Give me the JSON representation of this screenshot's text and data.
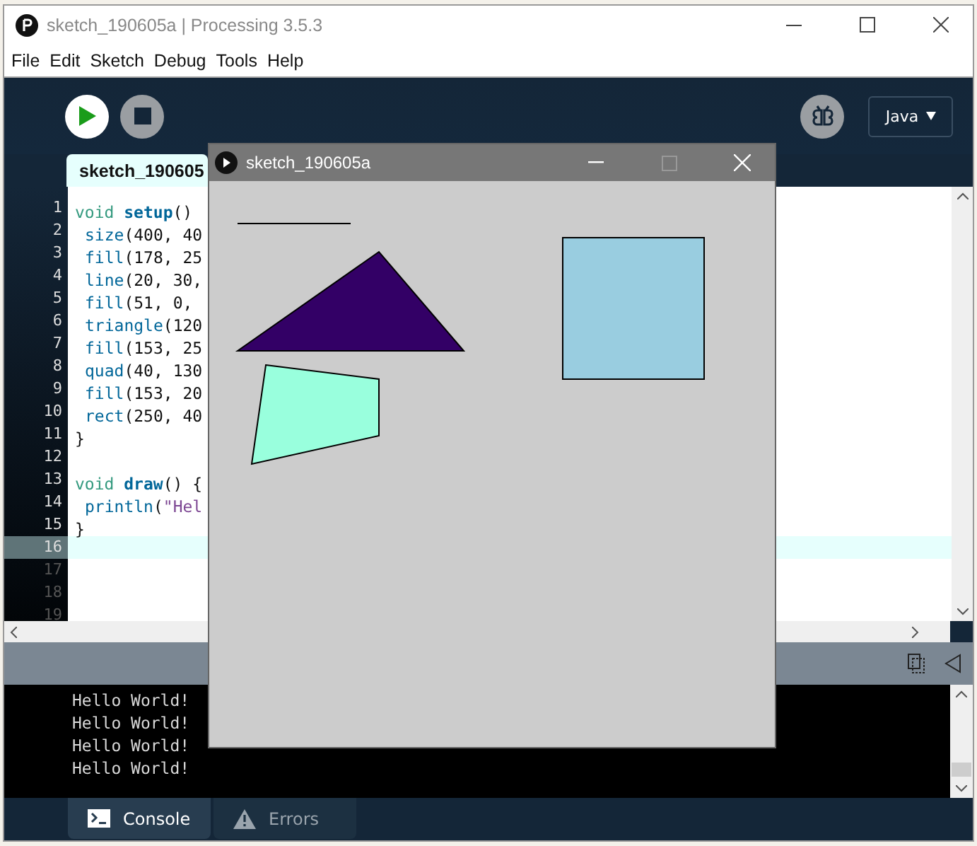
{
  "window": {
    "title": "sketch_190605a | Processing 3.5.3"
  },
  "menu": [
    "File",
    "Edit",
    "Sketch",
    "Debug",
    "Tools",
    "Help"
  ],
  "toolbar": {
    "mode": "Java"
  },
  "editor_tabs": [
    {
      "label": "sketch_190605",
      "selected": true
    }
  ],
  "code_lines": [
    {
      "number": "1",
      "current": false,
      "past_end": false,
      "tokens": [
        {
          "kind": "keyword",
          "text": "void "
        },
        {
          "kind": "definition",
          "text": "setup"
        },
        {
          "kind": "plain",
          "text": "()"
        }
      ]
    },
    {
      "number": "2",
      "current": false,
      "past_end": false,
      "indented": true,
      "tokens": [
        {
          "kind": "function",
          "text": "size"
        },
        {
          "kind": "plain",
          "text": "(400, 40"
        }
      ]
    },
    {
      "number": "3",
      "current": false,
      "past_end": false,
      "indented": true,
      "tokens": [
        {
          "kind": "function",
          "text": "fill"
        },
        {
          "kind": "plain",
          "text": "(178, 25"
        }
      ]
    },
    {
      "number": "4",
      "current": false,
      "past_end": false,
      "indented": true,
      "tokens": [
        {
          "kind": "function",
          "text": "line"
        },
        {
          "kind": "plain",
          "text": "(20, 30,"
        }
      ]
    },
    {
      "number": "5",
      "current": false,
      "past_end": false,
      "indented": true,
      "tokens": [
        {
          "kind": "function",
          "text": "fill"
        },
        {
          "kind": "plain",
          "text": "(51, 0,"
        }
      ]
    },
    {
      "number": "6",
      "current": false,
      "past_end": false,
      "indented": true,
      "tokens": [
        {
          "kind": "function",
          "text": "triangle"
        },
        {
          "kind": "plain",
          "text": "(120"
        }
      ]
    },
    {
      "number": "7",
      "current": false,
      "past_end": false,
      "indented": true,
      "tokens": [
        {
          "kind": "function",
          "text": "fill"
        },
        {
          "kind": "plain",
          "text": "(153, 25"
        }
      ]
    },
    {
      "number": "8",
      "current": false,
      "past_end": false,
      "indented": true,
      "tokens": [
        {
          "kind": "function",
          "text": "quad"
        },
        {
          "kind": "plain",
          "text": "(40, 130"
        }
      ]
    },
    {
      "number": "9",
      "current": false,
      "past_end": false,
      "indented": true,
      "tokens": [
        {
          "kind": "function",
          "text": "fill"
        },
        {
          "kind": "plain",
          "text": "(153, 20"
        }
      ]
    },
    {
      "number": "10",
      "current": false,
      "past_end": false,
      "indented": true,
      "tokens": [
        {
          "kind": "function",
          "text": "rect"
        },
        {
          "kind": "plain",
          "text": "(250, 40"
        }
      ]
    },
    {
      "number": "11",
      "current": false,
      "past_end": false,
      "tokens": [
        {
          "kind": "plain",
          "text": "}"
        }
      ]
    },
    {
      "number": "12",
      "current": false,
      "past_end": false
    },
    {
      "number": "13",
      "current": false,
      "past_end": false,
      "tokens": [
        {
          "kind": "keyword",
          "text": "void "
        },
        {
          "kind": "definition",
          "text": "draw"
        },
        {
          "kind": "plain",
          "text": "() {"
        }
      ]
    },
    {
      "number": "14",
      "current": false,
      "past_end": false,
      "indented": true,
      "tokens": [
        {
          "kind": "function",
          "text": "println"
        },
        {
          "kind": "plain",
          "text": "("
        },
        {
          "kind": "string",
          "text": "\"Hel"
        }
      ]
    },
    {
      "number": "15",
      "current": false,
      "past_end": false,
      "tokens": [
        {
          "kind": "plain",
          "text": "}"
        }
      ]
    },
    {
      "number": "16",
      "current": true,
      "past_end": false
    },
    {
      "number": "17",
      "current": false,
      "past_end": true
    },
    {
      "number": "18",
      "current": false,
      "past_end": true
    },
    {
      "number": "19",
      "current": false,
      "past_end": true
    }
  ],
  "console": {
    "lines": [
      "Hello World!",
      "Hello World!",
      "Hello World!",
      "Hello World!"
    ]
  },
  "bottom_tabs": [
    {
      "label": "Console",
      "kind": "console",
      "selected": true
    },
    {
      "label": "Errors",
      "kind": "errors",
      "selected": false
    }
  ],
  "sketch_window": {
    "title": "sketch_190605a",
    "shapes": [
      {
        "kind": "line"
      },
      {
        "kind": "triangle",
        "color": "#330066"
      },
      {
        "kind": "quad",
        "color": "#99ffdd"
      },
      {
        "kind": "rect",
        "color": "#99cde0"
      }
    ]
  }
}
